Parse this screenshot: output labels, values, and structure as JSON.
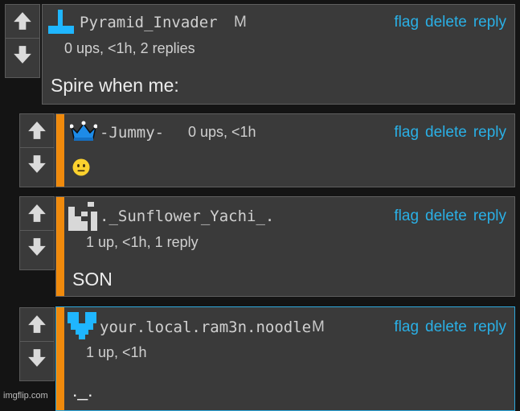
{
  "colors": {
    "background": "#141414",
    "card": "#3a3a3a",
    "link": "#2ab0e6",
    "accent_stripe": "#f08a0c",
    "active_border": "#2ea8dc",
    "avatar_blue": "#1fb6ff"
  },
  "actions": {
    "flag": "flag",
    "delete": "delete",
    "reply": "reply"
  },
  "comments": [
    {
      "username": "Pyramid_Invader",
      "badge": "M",
      "meta": "0 ups, <1h, 2 replies",
      "body": "Spire when me:",
      "avatar": "blue-pixel-icon"
    },
    {
      "username": "-Jummy-",
      "badge": "",
      "meta": "0 ups, <1h",
      "body": "",
      "body_icon": "neutral-face-emoji",
      "avatar": "crown-icon"
    },
    {
      "username": "._Sunflower_Yachi_.",
      "badge": "",
      "meta": "1 up, <1h, 1 reply",
      "body": "SON",
      "avatar": "white-pixel-icon"
    },
    {
      "username": "your.local.ram3n.noodle",
      "badge": "M",
      "meta": "1 up, <1h",
      "body": "._.",
      "avatar": "blue-heart-pixel-icon"
    }
  ],
  "watermark": "imgflip.com"
}
